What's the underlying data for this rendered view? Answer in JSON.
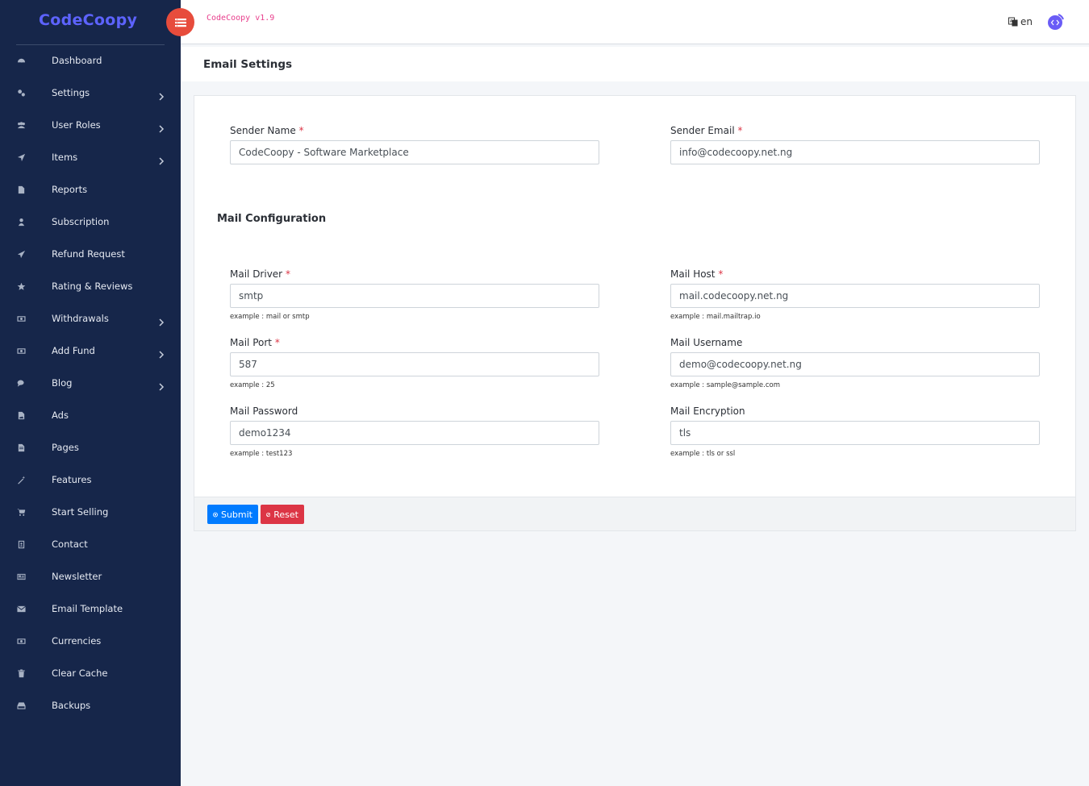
{
  "brand": {
    "logo_text": "CodeCoopy"
  },
  "topbar": {
    "app_version": "CodeCoopy v1.9",
    "language": "en"
  },
  "sidebar": {
    "items": [
      {
        "label": "Dashboard",
        "icon": "dashboard-icon",
        "has_submenu": false
      },
      {
        "label": "Settings",
        "icon": "gears-icon",
        "has_submenu": true
      },
      {
        "label": "User Roles",
        "icon": "users-icon",
        "has_submenu": true
      },
      {
        "label": "Items",
        "icon": "location-arrow-icon",
        "has_submenu": true
      },
      {
        "label": "Reports",
        "icon": "file-icon",
        "has_submenu": false
      },
      {
        "label": "Subscription",
        "icon": "user-icon",
        "has_submenu": false
      },
      {
        "label": "Refund Request",
        "icon": "paper-plane-icon",
        "has_submenu": false
      },
      {
        "label": "Rating & Reviews",
        "icon": "star-icon",
        "has_submenu": false
      },
      {
        "label": "Withdrawals",
        "icon": "money-icon",
        "has_submenu": true
      },
      {
        "label": "Add Fund",
        "icon": "money-icon",
        "has_submenu": true
      },
      {
        "label": "Blog",
        "icon": "comments-icon",
        "has_submenu": true
      },
      {
        "label": "Ads",
        "icon": "file-image-icon",
        "has_submenu": false
      },
      {
        "label": "Pages",
        "icon": "file-text-icon",
        "has_submenu": false
      },
      {
        "label": "Features",
        "icon": "magic-wand-icon",
        "has_submenu": false
      },
      {
        "label": "Start Selling",
        "icon": "shopping-cart-icon",
        "has_submenu": false
      },
      {
        "label": "Contact",
        "icon": "address-book-icon",
        "has_submenu": false
      },
      {
        "label": "Newsletter",
        "icon": "newspaper-icon",
        "has_submenu": false
      },
      {
        "label": "Email Template",
        "icon": "envelope-icon",
        "has_submenu": false
      },
      {
        "label": "Currencies",
        "icon": "money-icon",
        "has_submenu": false
      },
      {
        "label": "Clear Cache",
        "icon": "trash-icon",
        "has_submenu": false
      },
      {
        "label": "Backups",
        "icon": "hdd-icon",
        "has_submenu": false
      }
    ]
  },
  "page": {
    "title": "Email Settings"
  },
  "form": {
    "sender_name": {
      "label": "Sender Name",
      "required": "*",
      "value": "CodeCoopy - Software Marketplace"
    },
    "sender_email": {
      "label": "Sender Email",
      "required": "*",
      "value": "info@codecoopy.net.ng"
    },
    "section_title": "Mail Configuration",
    "mail_driver": {
      "label": "Mail Driver",
      "required": "*",
      "value": "smtp",
      "hint": "example : mail or smtp"
    },
    "mail_host": {
      "label": "Mail Host",
      "required": "*",
      "value": "mail.codecoopy.net.ng",
      "hint": "example : mail.mailtrap.io"
    },
    "mail_port": {
      "label": "Mail Port",
      "required": "*",
      "value": "587",
      "hint": "example : 25"
    },
    "mail_username": {
      "label": "Mail Username",
      "value": "demo@codecoopy.net.ng",
      "hint": "example : sample@sample.com"
    },
    "mail_password": {
      "label": "Mail Password",
      "value": "demo1234",
      "hint": "example : test123"
    },
    "mail_encryption": {
      "label": "Mail Encryption",
      "value": "tls",
      "hint": "example : tls or ssl"
    }
  },
  "buttons": {
    "submit": "Submit",
    "reset": "Reset"
  },
  "colors": {
    "sidebar_bg": "#16264a",
    "toggle": "#e74c3c",
    "submit": "#007bff",
    "reset": "#dc3545",
    "brand": "#5d63ff"
  }
}
